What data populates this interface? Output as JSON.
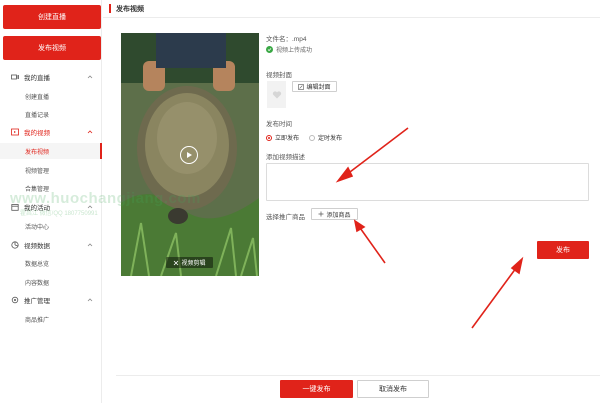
{
  "sidebar": {
    "create_live": "创建直播",
    "publish_video": "发布视频",
    "groups": [
      {
        "label": "我的直播",
        "items": [
          "创建直播",
          "直播记录"
        ]
      },
      {
        "label": "我的视频",
        "items": [
          "发布视频",
          "视频管理",
          "合集管理"
        ]
      },
      {
        "label": "我的活动",
        "items": [
          "活动中心"
        ]
      },
      {
        "label": "视频数据",
        "items": [
          "数据总览",
          "内容数据"
        ]
      },
      {
        "label": "推广管理",
        "items": [
          "商品推广"
        ]
      }
    ]
  },
  "header": {
    "title": "发布视频"
  },
  "video": {
    "edit_label": "视频剪辑"
  },
  "form": {
    "filename": "文件名：.mp4",
    "upload_status": "视频上传成功",
    "cover_label": "视频封面",
    "edit_cover": "编辑封面",
    "time_label": "发布时间",
    "publish_now": "立即发布",
    "publish_scheduled": "定时发布",
    "desc_label": "添加视频描述",
    "promo_label": "选择推广商品",
    "add_product": "添加商品",
    "publish": "发布"
  },
  "footer": {
    "onekey_publish": "一键发布",
    "cancel_publish": "取消发布"
  },
  "watermark": {
    "main": "www.huochangjiang.com",
    "sub": "霍昌江 微信/QQ 1807750991"
  },
  "colors": {
    "accent": "#e0231a",
    "success": "#3aa845",
    "arrow": "#e0231a"
  }
}
